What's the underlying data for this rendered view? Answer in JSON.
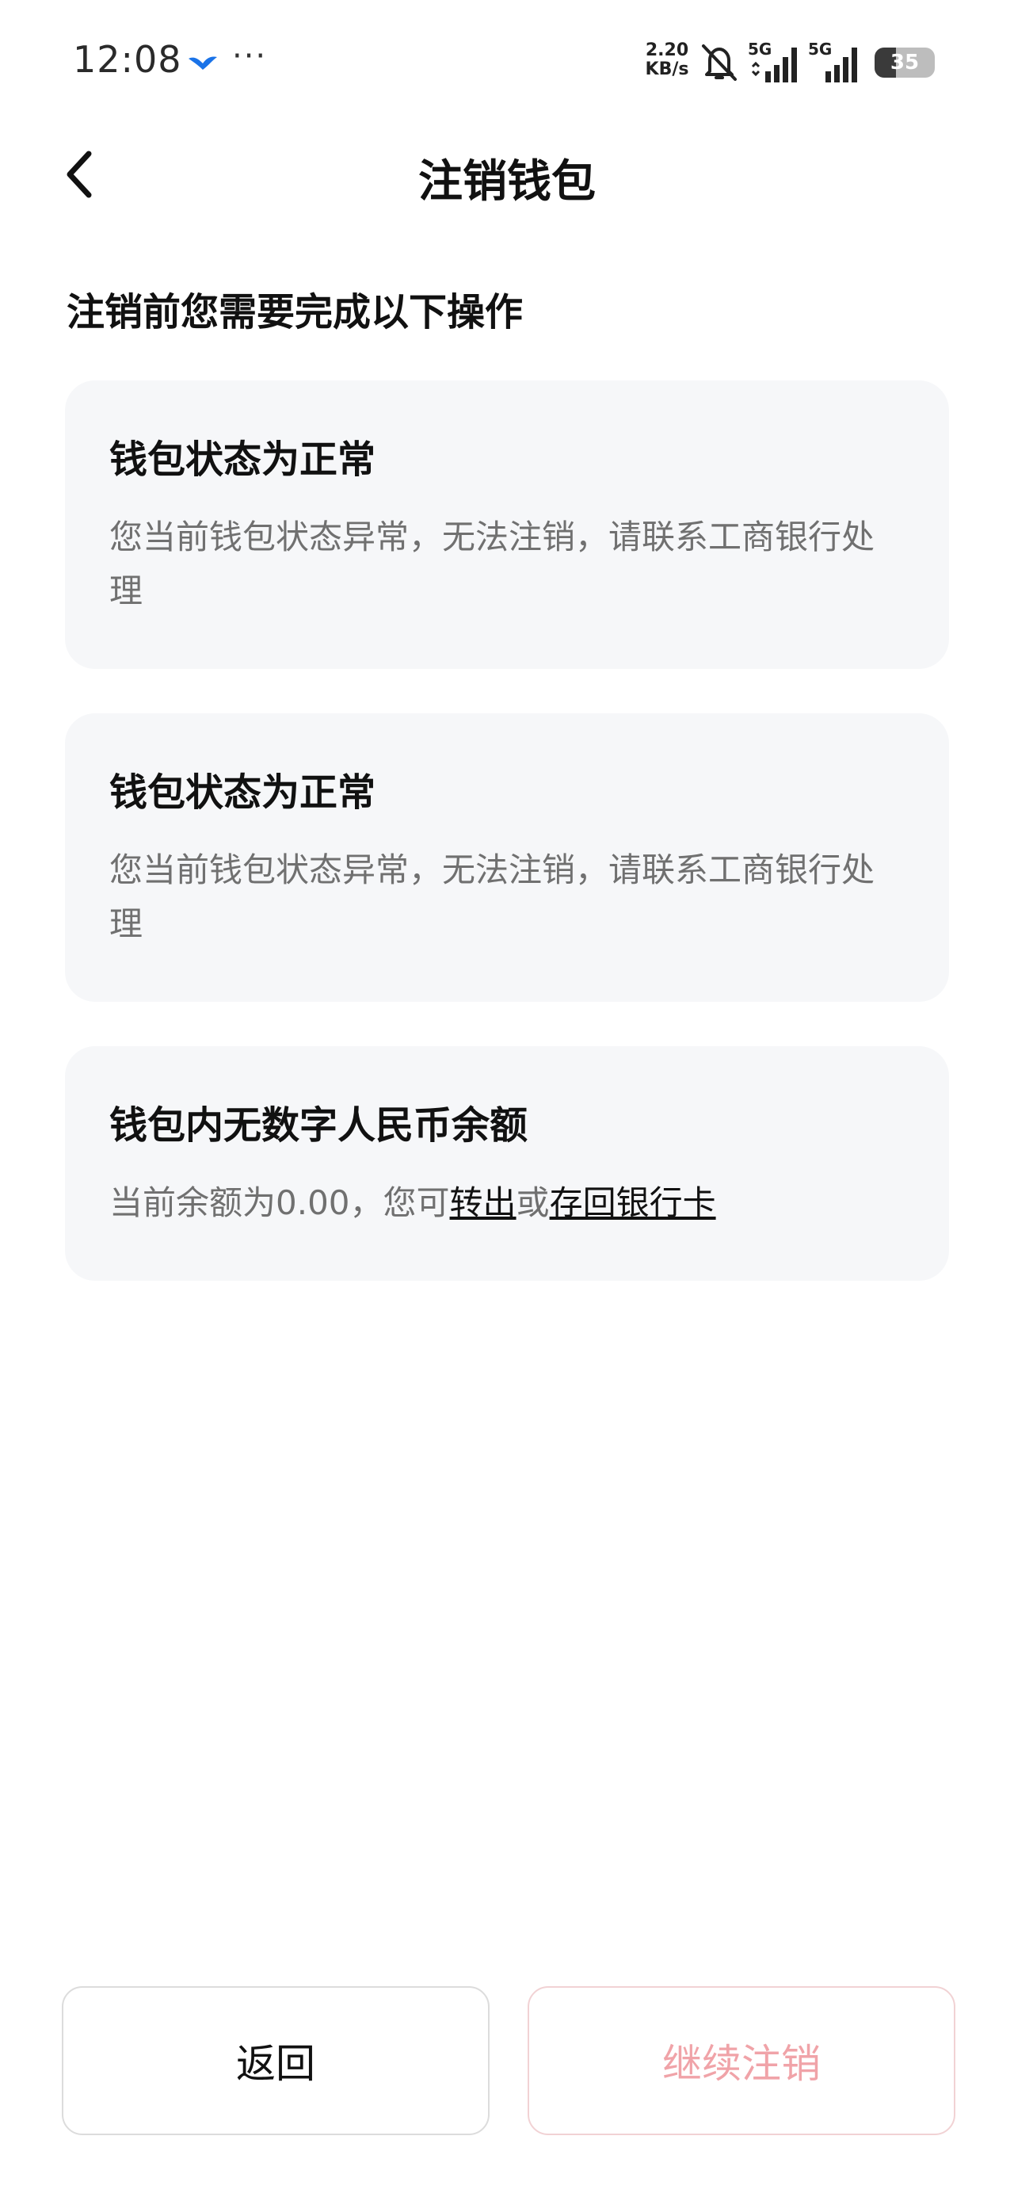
{
  "status_bar": {
    "time": "12:08",
    "more": "···",
    "net_speed_value": "2.20",
    "net_speed_unit": "KB/s",
    "signal_1_tag": "5G",
    "signal_2_tag": "5G",
    "battery_level": "35",
    "battery_fraction": 0.35,
    "icons": [
      "app-bird-icon",
      "bell-muted-icon",
      "signal-icon",
      "battery-icon"
    ]
  },
  "nav": {
    "title": "注销钱包",
    "back_icon": "chevron-left-icon"
  },
  "section_heading": "注销前您需要完成以下操作",
  "cards": [
    {
      "title": "钱包状态为正常",
      "desc": "您当前钱包状态异常，无法注销，请联系工商银行处理"
    },
    {
      "title": "钱包状态为正常",
      "desc": "您当前钱包状态异常，无法注销，请联系工商银行处理"
    },
    {
      "title": "钱包内无数字人民币余额",
      "desc_prefix": "当前余额为0.00，您可",
      "link_transfer": "转出",
      "desc_mid": "或",
      "link_deposit": "存回银行卡"
    }
  ],
  "buttons": {
    "back_label": "返回",
    "continue_label": "继续注销"
  },
  "colors": {
    "card_bg": "#f6f7f9",
    "desc_text": "#707070",
    "continue_disabled_text": "#f0a3a8",
    "continue_border": "#f1d2d4"
  }
}
